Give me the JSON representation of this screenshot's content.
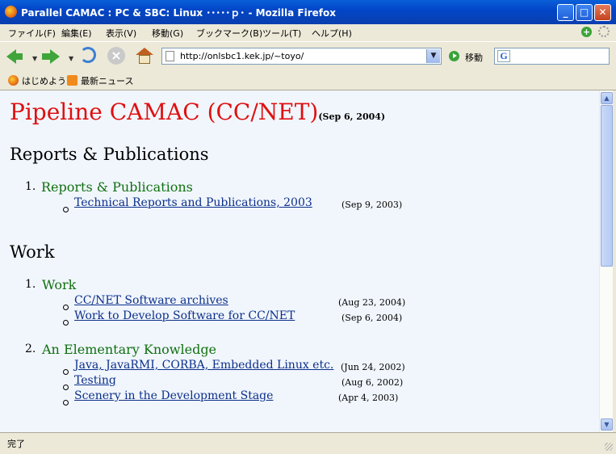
{
  "window": {
    "title": "Parallel CAMAC : PC & SBC: Linux ･････ｐ･ - Mozilla Firefox"
  },
  "menu": [
    "ファイル(F)",
    "編集(E)",
    "表示(V)",
    "移動(G)",
    "ブックマーク(B)",
    "ツール(T)",
    "ヘルプ(H)"
  ],
  "toolbar": {
    "url": "http://onlsbc1.kek.jp/~toyo/",
    "go_label": "移動",
    "search_logo": "G"
  },
  "bookmarks": [
    "はじめよう",
    "最新ニュース"
  ],
  "page": {
    "title": "Pipeline CAMAC (CC/NET)",
    "title_date": "(Sep 6, 2004)",
    "sections": [
      {
        "heading": "Reports & Publications",
        "groups": [
          {
            "num": "1.",
            "title": "Reports & Publications",
            "items": [
              {
                "label": "Technical Reports and Publications, 2003",
                "date": "(Sep 9, 2003)"
              }
            ]
          }
        ]
      },
      {
        "heading": "Work",
        "groups": [
          {
            "num": "1.",
            "title": "Work",
            "items": [
              {
                "label": "CC/NET Software archives",
                "date": "(Aug 23, 2004)"
              },
              {
                "label": "Work to Develop Software for CC/NET",
                "date": "(Sep 6, 2004)"
              }
            ]
          },
          {
            "num": "2.",
            "title": "An Elementary Knowledge",
            "items": [
              {
                "label": "Java, JavaRMI, CORBA, Embedded Linux etc.",
                "date": "(Jun 24, 2002)"
              },
              {
                "label": "Testing",
                "date": "(Aug 6, 2002)"
              },
              {
                "label": "Scenery in the Development Stage",
                "date": "(Apr 4, 2003)"
              }
            ]
          }
        ]
      }
    ]
  },
  "status": {
    "text": "完了"
  }
}
